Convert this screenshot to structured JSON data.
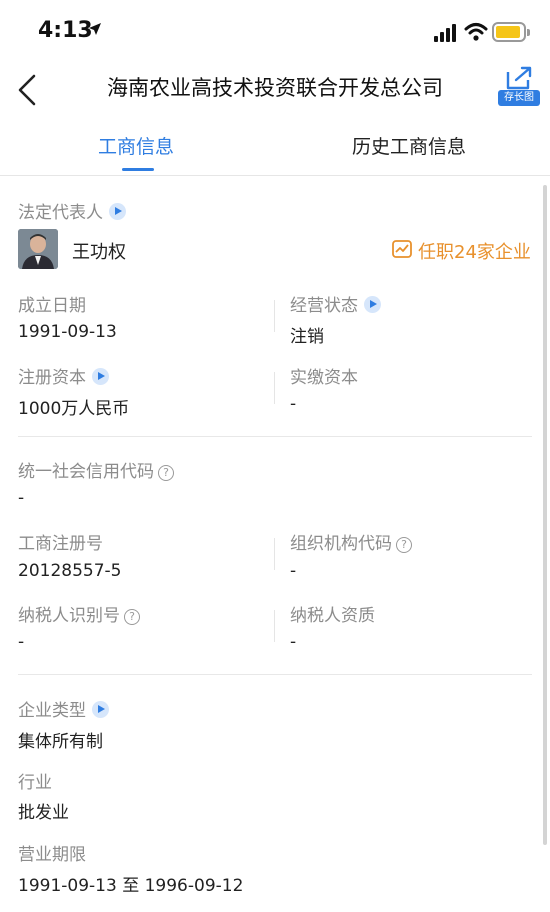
{
  "status_bar": {
    "time": "4:13"
  },
  "header": {
    "title": "海南农业高技术投资联合开发总公司",
    "share_label": "存长图"
  },
  "tabs": [
    {
      "label": "工商信息",
      "active": true
    },
    {
      "label": "历史工商信息",
      "active": false
    }
  ],
  "legal_rep": {
    "label": "法定代表人",
    "name": "王功权",
    "jobs": "任职24家企业"
  },
  "fields": {
    "established_label": "成立日期",
    "established_value": "1991-09-13",
    "status_label": "经营状态",
    "status_value": "注销",
    "reg_capital_label": "注册资本",
    "reg_capital_value": "1000万人民币",
    "paid_capital_label": "实缴资本",
    "paid_capital_value": "-",
    "credit_code_label": "统一社会信用代码",
    "credit_code_value": "-",
    "reg_no_label": "工商注册号",
    "reg_no_value": "20128557-5",
    "org_code_label": "组织机构代码",
    "org_code_value": "-",
    "taxpayer_id_label": "纳税人识别号",
    "taxpayer_id_value": "-",
    "taxpayer_qual_label": "纳税人资质",
    "taxpayer_qual_value": "-",
    "company_type_label": "企业类型",
    "company_type_value": "集体所有制",
    "industry_label": "行业",
    "industry_value": "批发业",
    "term_label": "营业期限",
    "term_value": "1991-09-13 至 1996-09-12"
  },
  "icons": {
    "back": "chevron-left-icon",
    "share": "share-export-icon",
    "info": "play-info-icon",
    "help": "question-circle-icon"
  },
  "colors": {
    "accent": "#2f7de1",
    "orange": "#e8912d"
  }
}
